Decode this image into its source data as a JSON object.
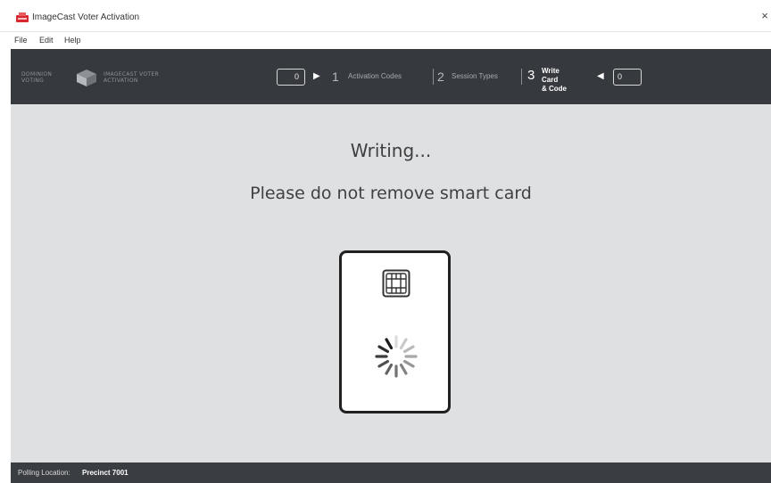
{
  "window": {
    "title": "ImageCast Voter Activation",
    "close_glyph": "×"
  },
  "menu": {
    "items": [
      "File",
      "Edit",
      "Help"
    ]
  },
  "header": {
    "logo": {
      "brand_text": "DOMINION VOTING",
      "product_text": "IMAGECAST VOTER ACTIVATION"
    },
    "left_counter": "0",
    "right_counter": "0",
    "steps": [
      {
        "number": "1",
        "label": "Activation Codes",
        "active": false
      },
      {
        "number": "2",
        "label": "Session Types",
        "active": false
      },
      {
        "number": "3",
        "label": "Write Card & Code",
        "label_line1": "Write Card",
        "label_line2": "& Code",
        "active": true
      }
    ]
  },
  "main": {
    "title": "Writing...",
    "subtitle": "Please do not remove smart card",
    "card_icon": "smart-card-chip-icon",
    "progress_icon": "loading-spinner-icon"
  },
  "statusbar": {
    "label": "Polling Location:",
    "value": "Precinct 7001"
  },
  "colors": {
    "header_bg": "#36393e",
    "content_bg": "#dfe0e2",
    "statusbar_bg": "#3a3d42",
    "app_icon": "#d6282e"
  }
}
